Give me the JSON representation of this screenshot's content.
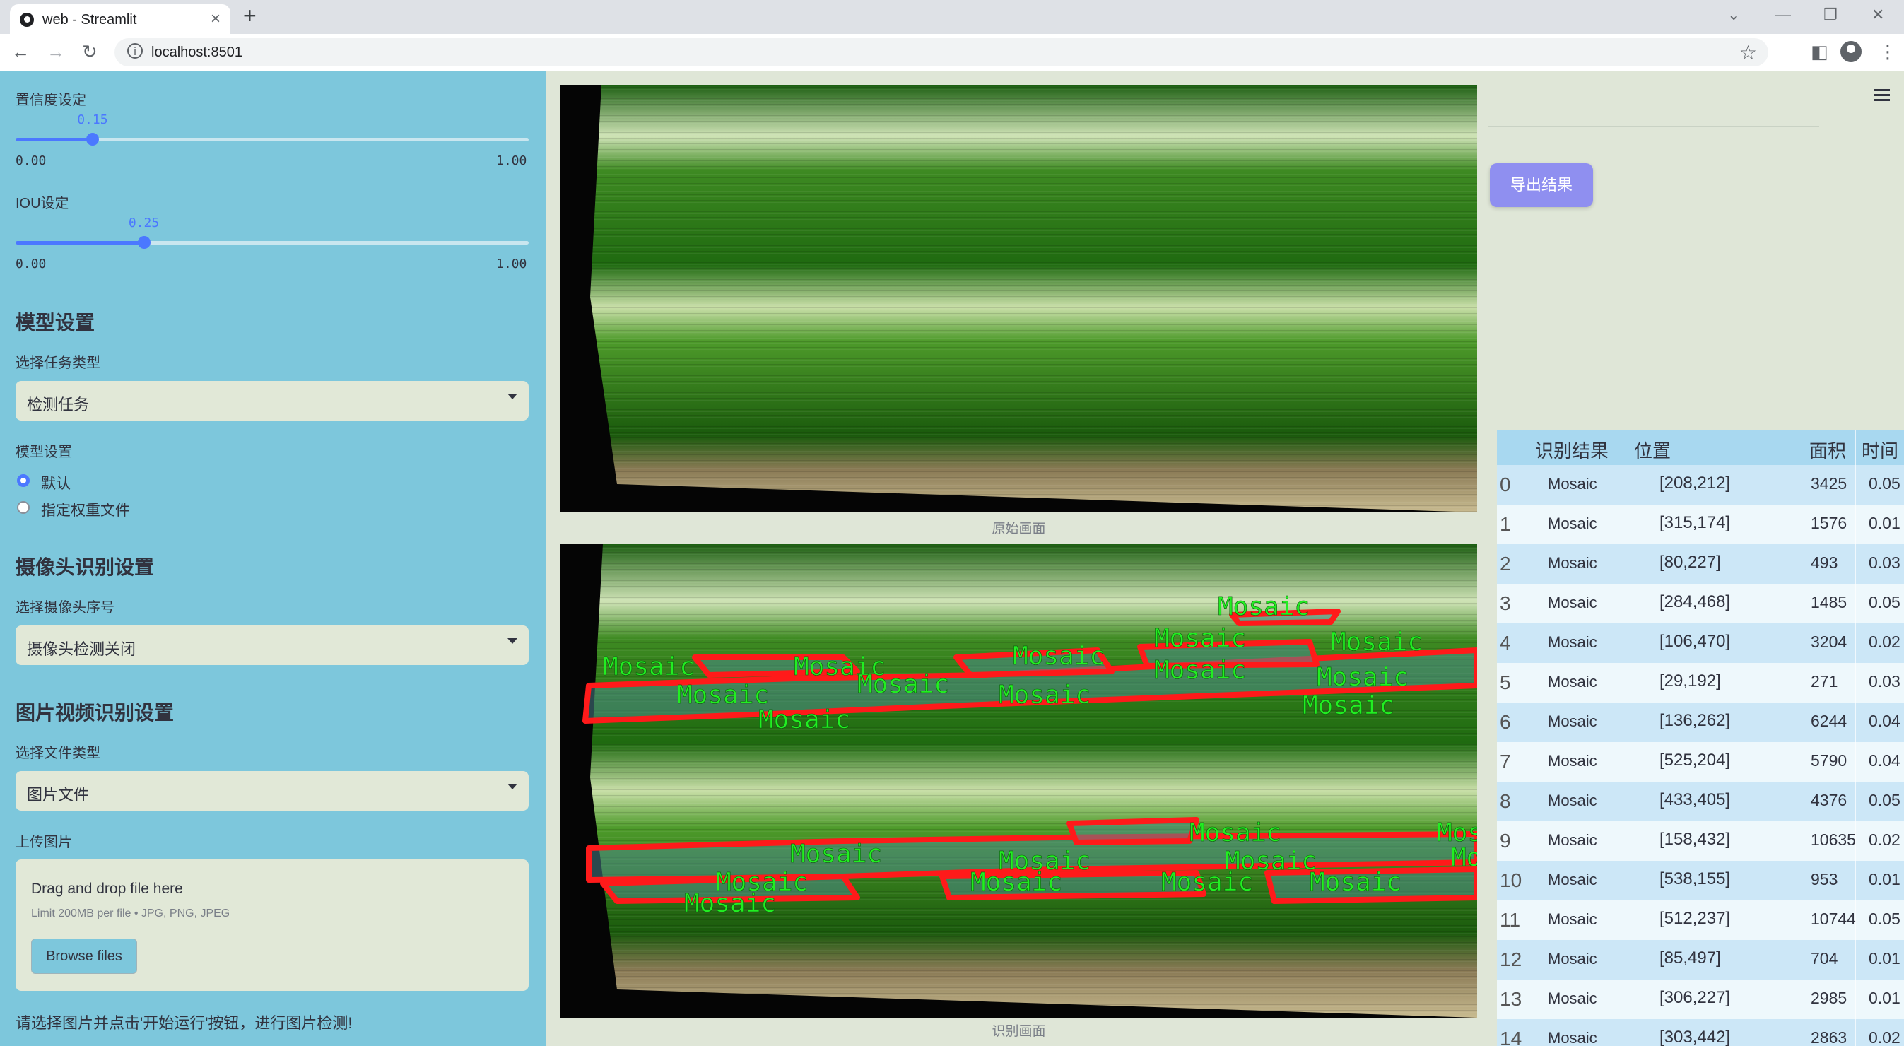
{
  "browser": {
    "tab_title": "web - Streamlit",
    "url": "localhost:8501"
  },
  "sidebar": {
    "confidence": {
      "label": "置信度设定",
      "value": 0.15,
      "value_text": "0.15",
      "min": "0.00",
      "max": "1.00"
    },
    "iou": {
      "label": "IOU设定",
      "value": 0.25,
      "value_text": "0.25",
      "min": "0.00",
      "max": "1.00"
    },
    "model_section": {
      "title": "模型设置",
      "task_label": "选择任务类型",
      "task_value": "检测任务",
      "model_label": "模型设置",
      "options": [
        "默认",
        "指定权重文件"
      ],
      "selected": "默认"
    },
    "camera_section": {
      "title": "摄像头识别设置",
      "camera_label": "选择摄像头序号",
      "camera_value": "摄像头检测关闭"
    },
    "media_section": {
      "title": "图片视频识别设置",
      "type_label": "选择文件类型",
      "type_value": "图片文件",
      "upload_label": "上传图片",
      "drop_text": "Drag and drop file here",
      "limit_text": "Limit 200MB per file • JPG, PNG, JPEG",
      "browse_label": "Browse files"
    },
    "footer_text": "请选择图片并点击'开始运行'按钮，进行图片检测!"
  },
  "main": {
    "original_caption": "原始画面",
    "result_caption": "识别画面",
    "detection_label": "Mosaic",
    "export_label": "导出结果"
  },
  "table": {
    "headers": [
      "识别结果",
      "位置",
      "面积",
      "时间"
    ],
    "rows": [
      {
        "idx": "0",
        "result": "Mosaic",
        "pos": "[208,212]",
        "area": "3425",
        "time": "0.05"
      },
      {
        "idx": "1",
        "result": "Mosaic",
        "pos": "[315,174]",
        "area": "1576",
        "time": "0.01"
      },
      {
        "idx": "2",
        "result": "Mosaic",
        "pos": "[80,227]",
        "area": "493",
        "time": "0.03"
      },
      {
        "idx": "3",
        "result": "Mosaic",
        "pos": "[284,468]",
        "area": "1485",
        "time": "0.05"
      },
      {
        "idx": "4",
        "result": "Mosaic",
        "pos": "[106,470]",
        "area": "3204",
        "time": "0.02"
      },
      {
        "idx": "5",
        "result": "Mosaic",
        "pos": "[29,192]",
        "area": "271",
        "time": "0.03"
      },
      {
        "idx": "6",
        "result": "Mosaic",
        "pos": "[136,262]",
        "area": "6244",
        "time": "0.04"
      },
      {
        "idx": "7",
        "result": "Mosaic",
        "pos": "[525,204]",
        "area": "5790",
        "time": "0.04"
      },
      {
        "idx": "8",
        "result": "Mosaic",
        "pos": "[433,405]",
        "area": "4376",
        "time": "0.05"
      },
      {
        "idx": "9",
        "result": "Mosaic",
        "pos": "[158,432]",
        "area": "10635",
        "time": "0.02"
      },
      {
        "idx": "10",
        "result": "Mosaic",
        "pos": "[538,155]",
        "area": "953",
        "time": "0.01"
      },
      {
        "idx": "11",
        "result": "Mosaic",
        "pos": "[512,237]",
        "area": "10744",
        "time": "0.05"
      },
      {
        "idx": "12",
        "result": "Mosaic",
        "pos": "[85,497]",
        "area": "704",
        "time": "0.01"
      },
      {
        "idx": "13",
        "result": "Mosaic",
        "pos": "[306,227]",
        "area": "2985",
        "time": "0.01"
      },
      {
        "idx": "14",
        "result": "Mosaic",
        "pos": "[303,442]",
        "area": "2863",
        "time": "0.02"
      }
    ]
  },
  "colors": {
    "sidebar_bg": "#7dc7dc",
    "accent": "#4b78ff",
    "export_button": "#8f8ff0",
    "table_row_alt": "#cce7f7",
    "detection_outline": "#ff1010",
    "detection_text": "#22ee22"
  }
}
